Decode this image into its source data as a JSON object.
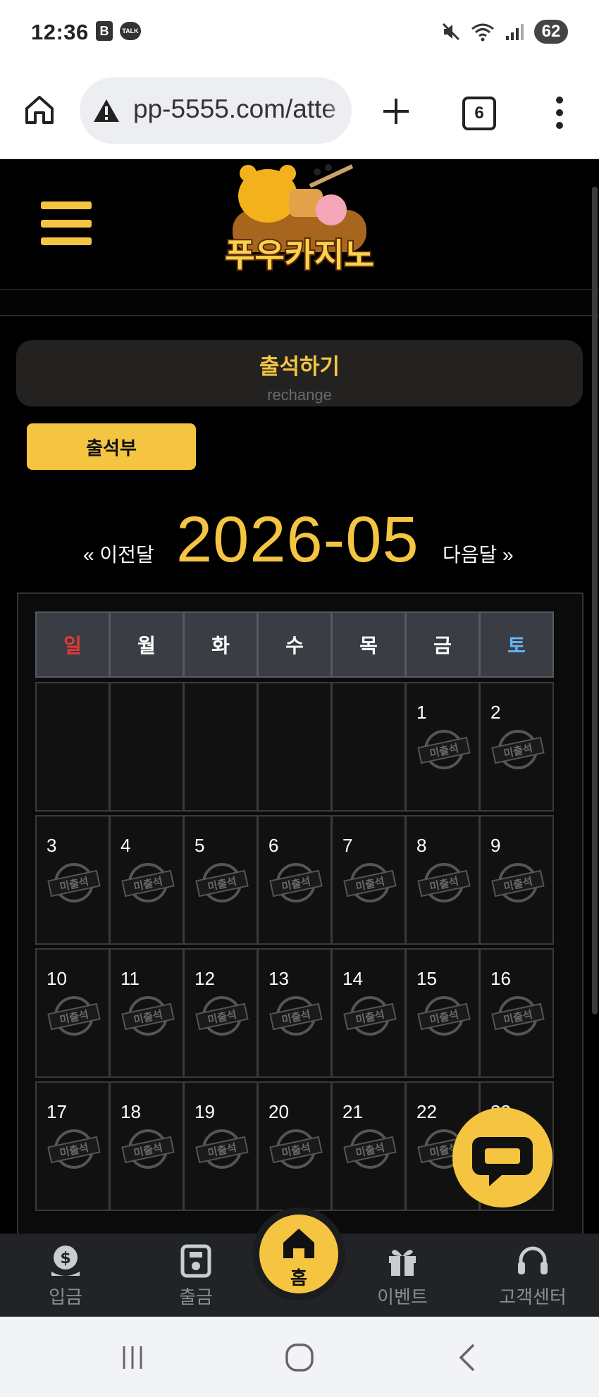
{
  "status_bar": {
    "time": "12:36",
    "b_badge": "B",
    "talk_badge": "TALK",
    "battery": "62"
  },
  "browser": {
    "url": "pp-5555.com/atte",
    "tab_count": "6"
  },
  "site": {
    "logo_text": "푸우카지노",
    "accent_color": "#f5c542"
  },
  "attendance": {
    "title": "출석하기",
    "subtitle": "rechange",
    "book_button": "출석부",
    "prev_month": "« 이전달",
    "month": "2026-05",
    "next_month": "다음달 »"
  },
  "calendar": {
    "weekdays": [
      "일",
      "월",
      "화",
      "수",
      "목",
      "금",
      "토"
    ],
    "stamp_label": "미출석",
    "rows": [
      [
        "",
        "",
        "",
        "",
        "",
        "1",
        "2"
      ],
      [
        "3",
        "4",
        "5",
        "6",
        "7",
        "8",
        "9"
      ],
      [
        "10",
        "11",
        "12",
        "13",
        "14",
        "15",
        "16"
      ],
      [
        "17",
        "18",
        "19",
        "20",
        "21",
        "22",
        "23"
      ]
    ]
  },
  "bottom_nav": {
    "deposit": "입금",
    "withdraw": "출금",
    "home": "홈",
    "event": "이벤트",
    "support": "고객센터"
  }
}
